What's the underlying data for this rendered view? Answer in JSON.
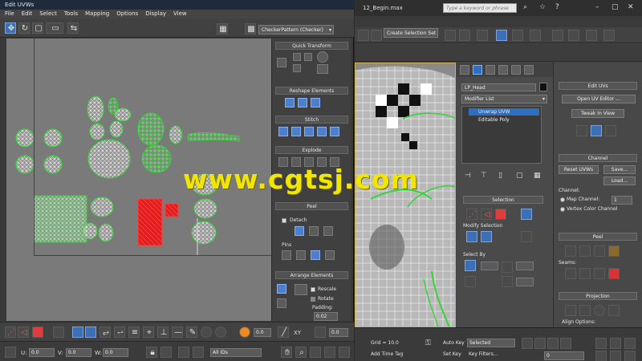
{
  "uvw_window": {
    "title": "Edit UVWs",
    "menu": [
      "File",
      "Edit",
      "Select",
      "Tools",
      "Mapping",
      "Options",
      "Display",
      "View"
    ],
    "uv_label": "UV",
    "pattern_dropdown": "CheckerPattern (Checker)",
    "rollouts": {
      "quick_transform": "Quick Transform",
      "reshape_elements": "Reshape Elements",
      "stitch": "Stitch",
      "explode": "Explode",
      "peel": "Peel",
      "arrange_elements": "Arrange Elements"
    },
    "peel_options": {
      "detach": "Detach",
      "pins": "Pins"
    },
    "arrange_options": {
      "rescale": "Rescale",
      "rotate": "Rotate",
      "padding": "Padding:",
      "padding_value": "0.02"
    },
    "bottom_spin_1": "0.0",
    "bottom_spin_2": "0.0",
    "bottom_u": "U:",
    "bottom_v": "V:",
    "bottom_w": "W:",
    "bottom_u_val": "0.0",
    "bottom_v_val": "0.0",
    "bottom_w_val": "0.0",
    "zoom_value": "All IDs",
    "xy_label": "XY"
  },
  "max_window": {
    "title": "12_Begin.max",
    "search_placeholder": "Type a keyword or phrase",
    "selection_set": "Create Selection Set",
    "object_name": "LP_Head",
    "modifier_list": "Modifier List",
    "stack": [
      {
        "label": "Unwrap UVW",
        "selected": true
      },
      {
        "label": "Editable Poly",
        "selected": false
      }
    ],
    "selection_rollout": "Selection",
    "modify_selection": "Modify Selection",
    "select_by": "Select By",
    "edit_uvs": "Edit UVs",
    "open_uv_editor": "Open UV Editor ...",
    "tweak_in_view": "Tweak In View",
    "channel_head": "Channel",
    "reset_uvws": "Reset UVWs",
    "save": "Save...",
    "load": "Load...",
    "channel_label": "Channel:",
    "map_channel": "Map Channel:",
    "map_channel_value": "1",
    "vertex_color_channel": "Vertex Color Channel",
    "peel_head": "Peel",
    "seams_label": "Seams:",
    "projection_head": "Projection",
    "align_options": "Align Options:",
    "timeline_ticks": [
      "50",
      "55"
    ],
    "status_selected": "1 Object Selected",
    "status_auto_key": "Auto Key",
    "status_selected_dropdown": "Selected",
    "status_set_key": "Set Key",
    "status_key_filters": "Key Filters...",
    "status_grid": "Grid = 10.0",
    "status_add_time_tag": "Add Time Tag",
    "frame_value": "0"
  },
  "watermark": "www.cgtsj.com",
  "colors": {
    "uv_green": "#39d23a",
    "uv_white": "#f0f0f0",
    "uv_red": "#e81c1c",
    "highlight_blue": "#2f6fc0",
    "watermark": "#f2e600"
  }
}
